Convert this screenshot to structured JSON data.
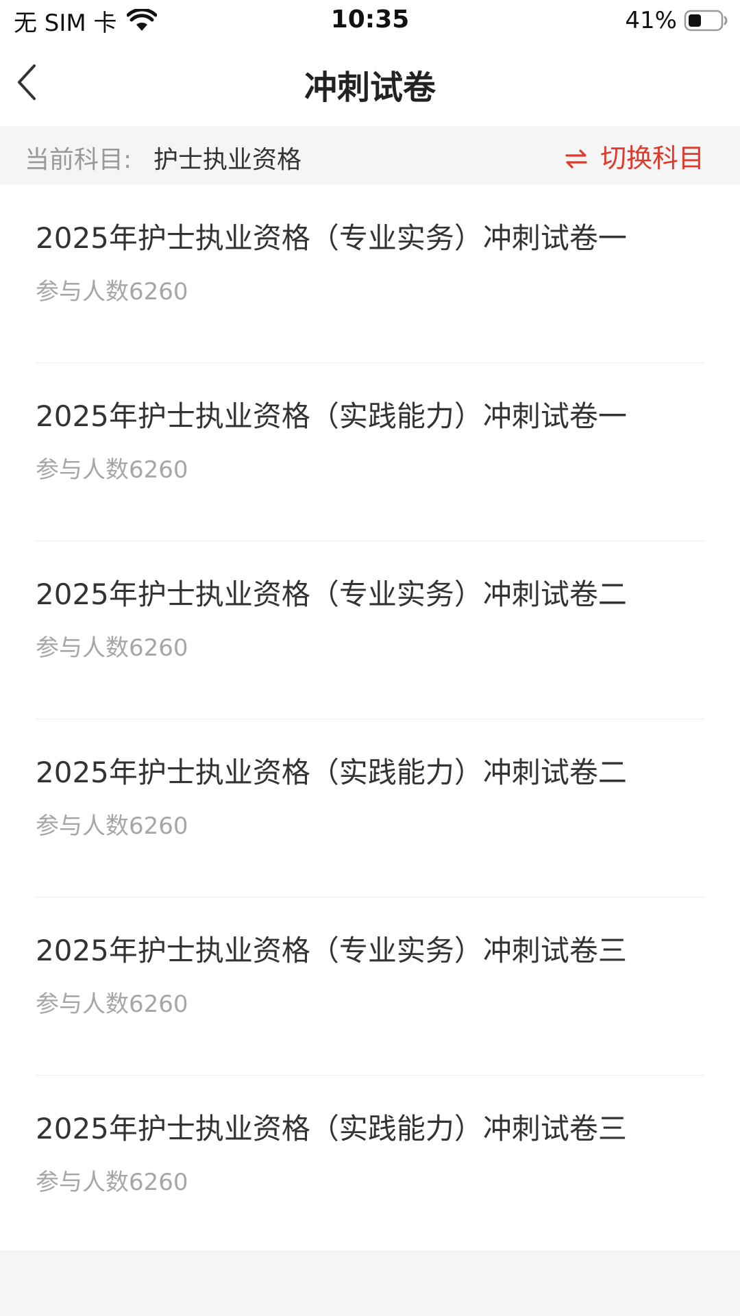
{
  "status_bar": {
    "carrier": "无 SIM 卡",
    "time": "10:35",
    "battery_percent": "41%",
    "battery_level": 0.41,
    "icons": [
      "wifi-icon",
      "battery-icon"
    ]
  },
  "nav": {
    "title": "冲刺试卷",
    "back_icon": "chevron-left-icon"
  },
  "subject": {
    "label": "当前科目:",
    "value": "护士执业资格",
    "switch_label": "切换科目",
    "switch_icon": "swap-arrows-icon"
  },
  "papers": [
    {
      "title": "2025年护士执业资格（专业实务）冲刺试卷一",
      "participants": "参与人数6260"
    },
    {
      "title": "2025年护士执业资格（实践能力）冲刺试卷一",
      "participants": "参与人数6260"
    },
    {
      "title": "2025年护士执业资格（专业实务）冲刺试卷二",
      "participants": "参与人数6260"
    },
    {
      "title": "2025年护士执业资格（实践能力）冲刺试卷二",
      "participants": "参与人数6260"
    },
    {
      "title": "2025年护士执业资格（专业实务）冲刺试卷三",
      "participants": "参与人数6260"
    },
    {
      "title": "2025年护士执业资格（实践能力）冲刺试卷三",
      "participants": "参与人数6260"
    }
  ],
  "colors": {
    "accent": "#e0382b",
    "subject_bar_bg": "#f5f5f5",
    "secondary_text": "#a6a6a6"
  }
}
